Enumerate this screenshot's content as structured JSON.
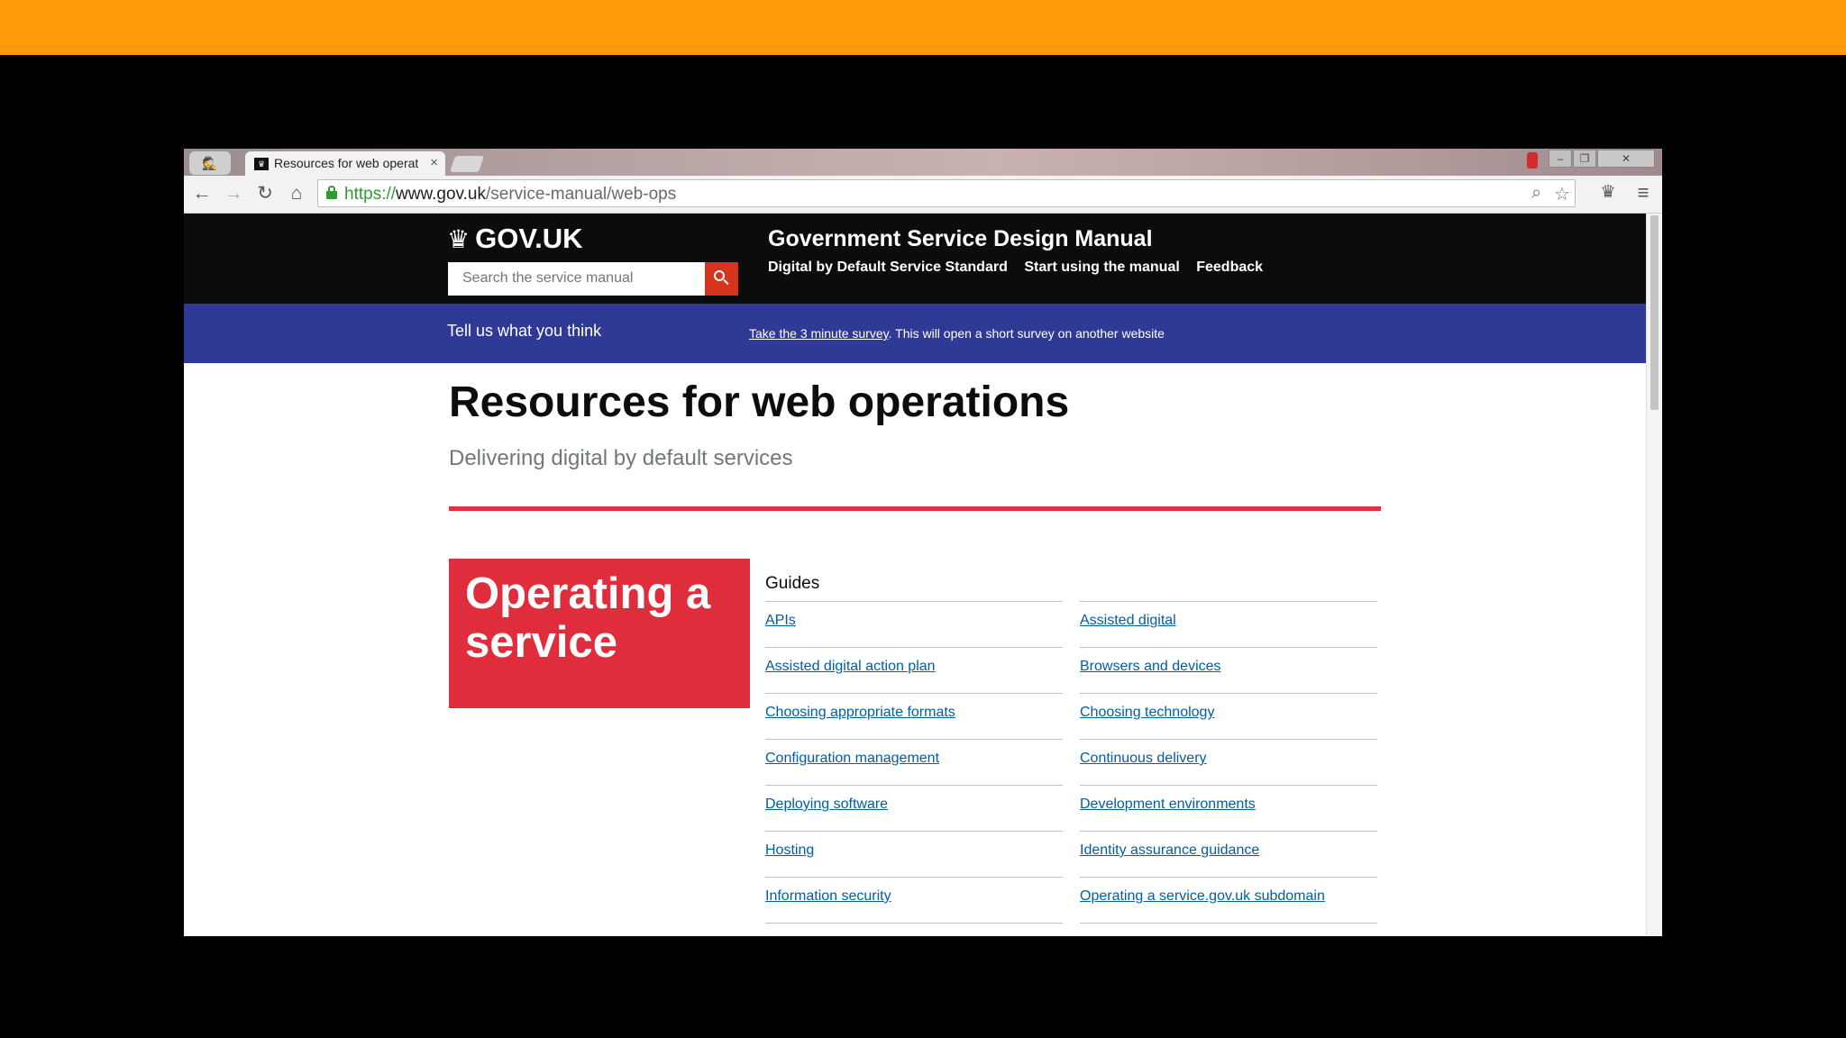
{
  "browser": {
    "tab_title": "Resources for web operati",
    "tab_close": "×",
    "url_scheme": "https://",
    "url_host": "www.gov.uk",
    "url_path": "/service-manual/web-ops",
    "window_controls": [
      "–",
      "❐",
      "✕"
    ]
  },
  "header": {
    "logo_text": "GOV.UK",
    "search_placeholder": "Search the service manual",
    "manual_title": "Government Service Design Manual",
    "nav": [
      "Digital by Default Service Standard",
      "Start using the manual",
      "Feedback"
    ]
  },
  "survey": {
    "title": "Tell us what you think",
    "link": "Take the 3 minute survey",
    "text": ". This will open a short survey on another website"
  },
  "main": {
    "title": "Resources for web operations",
    "subtitle": "Delivering digital by default services",
    "section_title": "Operating a service",
    "guides_heading": "Guides",
    "guides_left": [
      "APIs",
      "Assisted digital action plan",
      "Choosing appropriate formats",
      "Configuration management",
      "Deploying software",
      "Hosting",
      "Information security"
    ],
    "guides_right": [
      "Assisted digital",
      "Browsers and devices",
      "Choosing technology",
      "Continuous delivery",
      "Development environments",
      "Identity assurance guidance",
      "Operating a service.gov.uk subdomain"
    ]
  },
  "colors": {
    "top_bar": "#ff9b0b",
    "gov_header": "#0b0c0c",
    "survey_banner": "#2e3a96",
    "accent_red": "#e02d3c",
    "link": "#005ea5"
  }
}
